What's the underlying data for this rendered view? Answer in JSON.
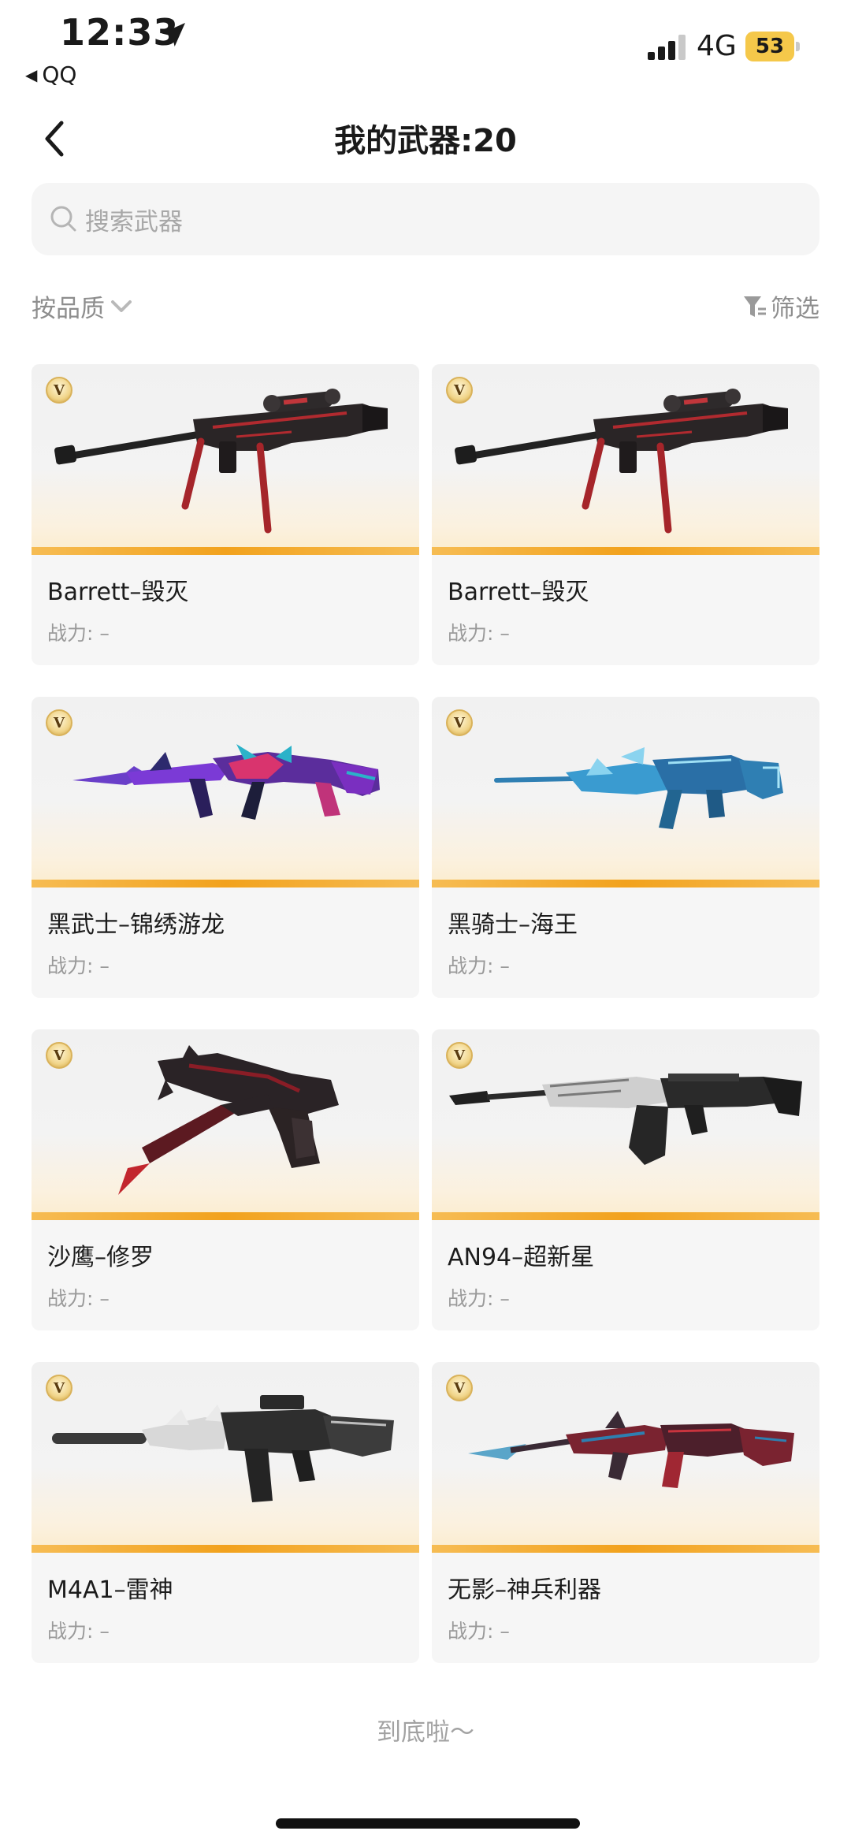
{
  "status_bar": {
    "time": "12:33",
    "back_app": "QQ",
    "network": "4G",
    "battery": "53"
  },
  "header": {
    "title": "我的武器:20"
  },
  "search": {
    "placeholder": "搜索武器"
  },
  "sort": {
    "label": "按品质",
    "filter_label": "筛选"
  },
  "weapons": [
    {
      "name": "Barrett–毁灭",
      "power": "战力: –",
      "badge": "V",
      "icon": "sniper-rifle-dark-red"
    },
    {
      "name": "Barrett–毁灭",
      "power": "战力: –",
      "badge": "V",
      "icon": "sniper-rifle-dark-red"
    },
    {
      "name": "黑武士–锦绣游龙",
      "power": "战力: –",
      "badge": "V",
      "icon": "rifle-purple-dragon"
    },
    {
      "name": "黑骑士–海王",
      "power": "战力: –",
      "badge": "V",
      "icon": "rifle-blue-ocean"
    },
    {
      "name": "沙鹰–修罗",
      "power": "战力: –",
      "badge": "V",
      "icon": "pistol-dark-red"
    },
    {
      "name": "AN94–超新星",
      "power": "战力: –",
      "badge": "V",
      "icon": "rifle-silver-black"
    },
    {
      "name": "M4A1–雷神",
      "power": "战力: –",
      "badge": "V",
      "icon": "rifle-silver-thunder"
    },
    {
      "name": "无影–神兵利器",
      "power": "战力: –",
      "badge": "V",
      "icon": "rifle-red-blue-blade"
    }
  ],
  "footer": {
    "end_text": "到底啦～"
  },
  "colors": {
    "accent_bar": "#f2a21d",
    "battery": "#f5c84a"
  }
}
